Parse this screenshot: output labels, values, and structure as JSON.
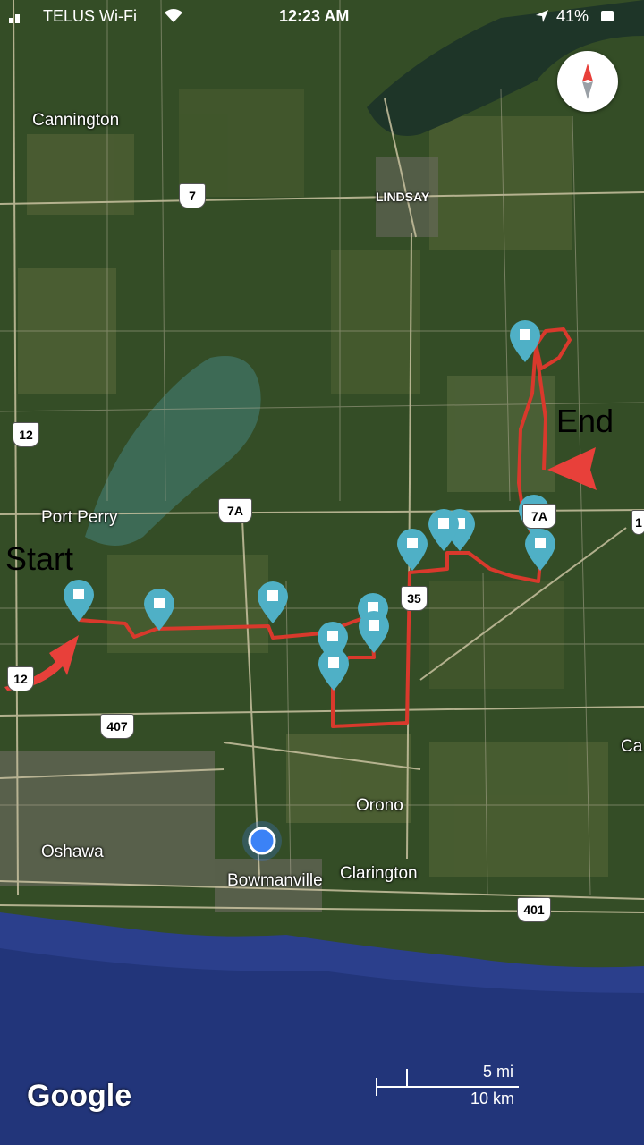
{
  "status_bar": {
    "carrier": "TELUS Wi-Fi",
    "time": "12:23 AM",
    "battery": "41%"
  },
  "places": [
    {
      "name": "Cannington",
      "icon": "place"
    },
    {
      "name": "LINDSAY",
      "icon": "place"
    },
    {
      "name": "Port Perry",
      "icon": "place"
    },
    {
      "name": "Orono",
      "icon": "place"
    },
    {
      "name": "Oshawa",
      "icon": "place"
    },
    {
      "name": "Bowmanville",
      "icon": "place"
    },
    {
      "name": "Clarington",
      "icon": "place"
    },
    {
      "name": "Ca",
      "icon": "place"
    }
  ],
  "route_shields": [
    "7",
    "12",
    "7A",
    "407",
    "35",
    "401",
    "12",
    "7A",
    "1"
  ],
  "annotations": {
    "start": "Start",
    "end": "End"
  },
  "scale": {
    "mi": "5 mi",
    "km": "10 km"
  },
  "logo": "Google",
  "colors": {
    "route": "#d9392c",
    "pin": "#4fb0c6",
    "arrow": "#e8403a",
    "water": "#1f3a8a",
    "current_location": "#3b82f6"
  },
  "icons": [
    "compass-icon",
    "signal-icon",
    "wifi-icon",
    "location-arrow-icon",
    "battery-icon",
    "map-pin-icon"
  ]
}
